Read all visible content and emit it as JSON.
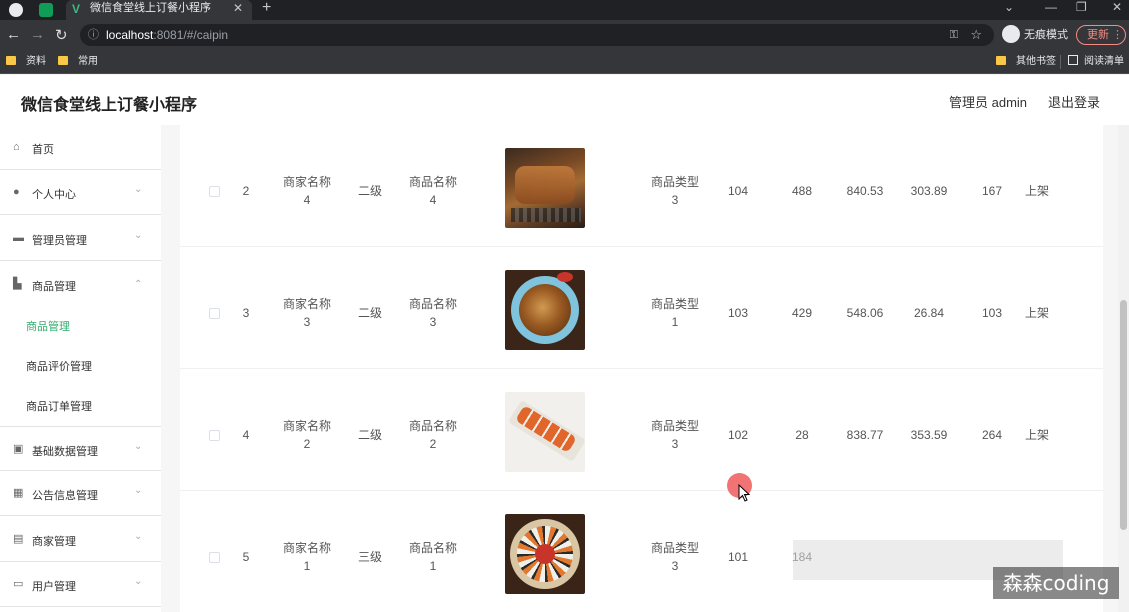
{
  "browser": {
    "tab_title": "微信食堂线上订餐小程序",
    "url_host": "localhost",
    "url_path": ":8081/#/caipin",
    "incognito_label": "无痕模式",
    "update_label": "更新",
    "bookmarks": [
      "资料",
      "常用"
    ],
    "bookmarks_right": [
      "其他书签",
      "阅读清单"
    ]
  },
  "header": {
    "title": "微信食堂线上订餐小程序",
    "user_label": "管理员 admin",
    "logout_label": "退出登录"
  },
  "sidebar": {
    "items": [
      {
        "label": "首页",
        "icon": "home-icon",
        "expandable": false
      },
      {
        "label": "个人中心",
        "icon": "user-icon",
        "expandable": true
      },
      {
        "label": "管理员管理",
        "icon": "admin-icon",
        "expandable": true
      },
      {
        "label": "商品管理",
        "icon": "goods-icon",
        "expandable": true,
        "expanded": true
      },
      {
        "label": "基础数据管理",
        "icon": "data-icon",
        "expandable": true
      },
      {
        "label": "公告信息管理",
        "icon": "notice-icon",
        "expandable": true
      },
      {
        "label": "商家管理",
        "icon": "merchant-icon",
        "expandable": true
      },
      {
        "label": "用户管理",
        "icon": "users-icon",
        "expandable": true
      }
    ],
    "sub_items": [
      {
        "label": "商品管理",
        "active": true
      },
      {
        "label": "商品评价管理",
        "active": false
      },
      {
        "label": "商品订单管理",
        "active": false
      }
    ]
  },
  "table": {
    "rows": [
      {
        "index": "2",
        "merchant": [
          "商家名称",
          "4"
        ],
        "level": "二级",
        "goods": [
          "商品名称",
          "4"
        ],
        "image": "grilled-meat",
        "type": [
          "商品类型",
          "3"
        ],
        "c1": "104",
        "c2": "488",
        "c3": "840.53",
        "c4": "303.89",
        "c5": "167",
        "status": "上架"
      },
      {
        "index": "3",
        "merchant": [
          "商家名称",
          "3"
        ],
        "level": "二级",
        "goods": [
          "商品名称",
          "3"
        ],
        "image": "noodle-bowl",
        "type": [
          "商品类型",
          "1"
        ],
        "c1": "103",
        "c2": "429",
        "c3": "548.06",
        "c4": "26.84",
        "c5": "103",
        "status": "上架"
      },
      {
        "index": "4",
        "merchant": [
          "商家名称",
          "2"
        ],
        "level": "二级",
        "goods": [
          "商品名称",
          "2"
        ],
        "image": "sushi-roll",
        "type": [
          "商品类型",
          "3"
        ],
        "c1": "102",
        "c2": "28",
        "c3": "838.77",
        "c4": "353.59",
        "c5": "264",
        "status": "上架"
      },
      {
        "index": "5",
        "merchant": [
          "商家名称",
          "1"
        ],
        "level": "三级",
        "goods": [
          "商品名称",
          "1"
        ],
        "image": "sushi-platter",
        "type": [
          "商品类型",
          "3"
        ],
        "c1": "101",
        "c2": "184",
        "c3": "",
        "c4": "",
        "c5": "",
        "status": ""
      }
    ]
  },
  "watermark": "森森coding",
  "colors": {
    "accent": "#2eac6d",
    "cursor": "#ee5a5a"
  }
}
